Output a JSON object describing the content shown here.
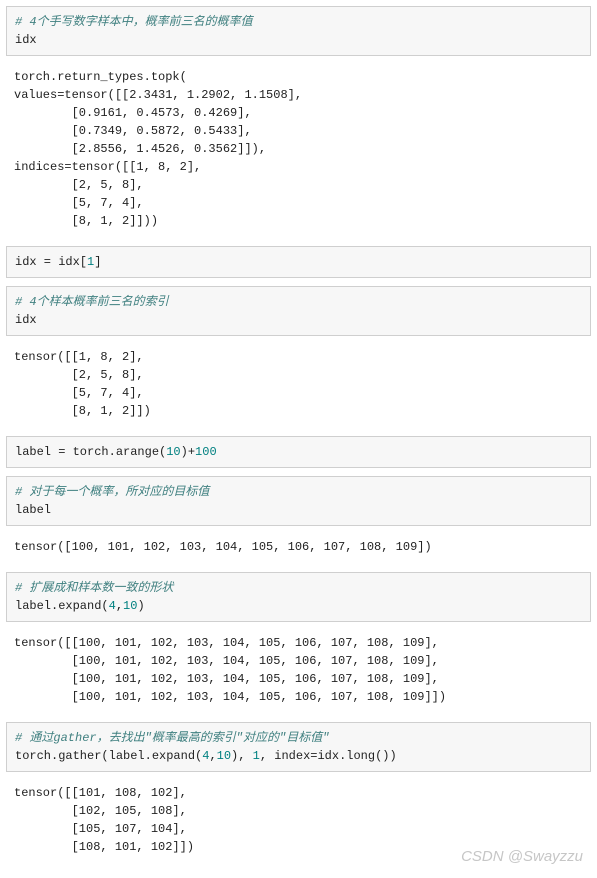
{
  "blocks": {
    "b1_comment": "# 4个手写数字样本中，概率前三名的概率值",
    "b1_code": "idx",
    "o1": "torch.return_types.topk(\nvalues=tensor([[2.3431, 1.2902, 1.1508],\n        [0.9161, 0.4573, 0.4269],\n        [0.7349, 0.5872, 0.5433],\n        [2.8556, 1.4526, 0.3562]]),\nindices=tensor([[1, 8, 2],\n        [2, 5, 8],\n        [5, 7, 4],\n        [8, 1, 2]]))",
    "b2_line": "idx = idx[",
    "b2_num": "1",
    "b2_end": "]",
    "b3_comment": "# 4个样本概率前三名的索引",
    "b3_code": "idx",
    "o3": "tensor([[1, 8, 2],\n        [2, 5, 8],\n        [5, 7, 4],\n        [8, 1, 2]])",
    "b4_a": "label = torch.arange(",
    "b4_n1": "10",
    "b4_b": ")+",
    "b4_n2": "100",
    "b5_comment": "# 对于每一个概率，所对应的目标值",
    "b5_code": "label",
    "o5": "tensor([100, 101, 102, 103, 104, 105, 106, 107, 108, 109])",
    "b6_comment": "# 扩展成和样本数一致的形状",
    "b6_a": "label.expand(",
    "b6_n1": "4",
    "b6_c": ",",
    "b6_n2": "10",
    "b6_b": ")",
    "o6": "tensor([[100, 101, 102, 103, 104, 105, 106, 107, 108, 109],\n        [100, 101, 102, 103, 104, 105, 106, 107, 108, 109],\n        [100, 101, 102, 103, 104, 105, 106, 107, 108, 109],\n        [100, 101, 102, 103, 104, 105, 106, 107, 108, 109]])",
    "b7_comment": "# 通过gather，去找出\"概率最高的索引\"对应的\"目标值\"",
    "b7_a": "torch.gather(label.expand(",
    "b7_n1": "4",
    "b7_c": ",",
    "b7_n2": "10",
    "b7_b": "), ",
    "b7_n3": "1",
    "b7_d": ", index=idx.long())",
    "o7": "tensor([[101, 108, 102],\n        [102, 105, 108],\n        [105, 107, 104],\n        [108, 101, 102]])"
  },
  "watermark": "CSDN @Swayzzu"
}
